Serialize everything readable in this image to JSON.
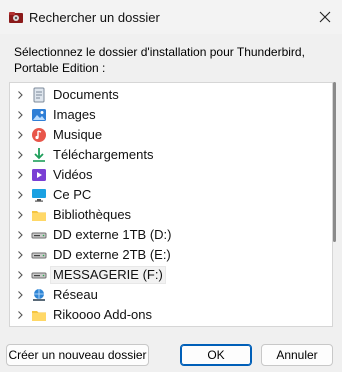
{
  "window": {
    "title": "Rechercher un dossier",
    "close_icon": "close-icon",
    "app_icon": "folder-app-icon"
  },
  "instruction": "Sélectionnez le dossier d'installation pour Thunderbird, Portable Edition :",
  "tree": {
    "items": [
      {
        "label": "Documents",
        "icon": "document-icon",
        "expandable": true,
        "selected": false
      },
      {
        "label": "Images",
        "icon": "images-icon",
        "expandable": true,
        "selected": false
      },
      {
        "label": "Musique",
        "icon": "music-icon",
        "expandable": true,
        "selected": false
      },
      {
        "label": "Téléchargements",
        "icon": "download-icon",
        "expandable": true,
        "selected": false
      },
      {
        "label": "Vidéos",
        "icon": "video-icon",
        "expandable": true,
        "selected": false
      },
      {
        "label": "Ce PC",
        "icon": "pc-icon",
        "expandable": true,
        "selected": false
      },
      {
        "label": "Bibliothèques",
        "icon": "folder-icon",
        "expandable": true,
        "selected": false
      },
      {
        "label": "DD externe 1TB (D:)",
        "icon": "drive-icon",
        "expandable": true,
        "selected": false
      },
      {
        "label": "DD externe 2TB (E:)",
        "icon": "drive-icon",
        "expandable": true,
        "selected": false
      },
      {
        "label": "MESSAGERIE (F:)",
        "icon": "drive-icon",
        "expandable": true,
        "selected": true
      },
      {
        "label": "Réseau",
        "icon": "network-icon",
        "expandable": true,
        "selected": false
      },
      {
        "label": "Rikoooo Add-ons",
        "icon": "folder-icon",
        "expandable": true,
        "selected": false
      }
    ]
  },
  "buttons": {
    "new_folder": "Créer un nouveau dossier",
    "ok": "OK",
    "cancel": "Annuler"
  },
  "colors": {
    "accent": "#005fb8",
    "background": "#f0f0f0"
  }
}
